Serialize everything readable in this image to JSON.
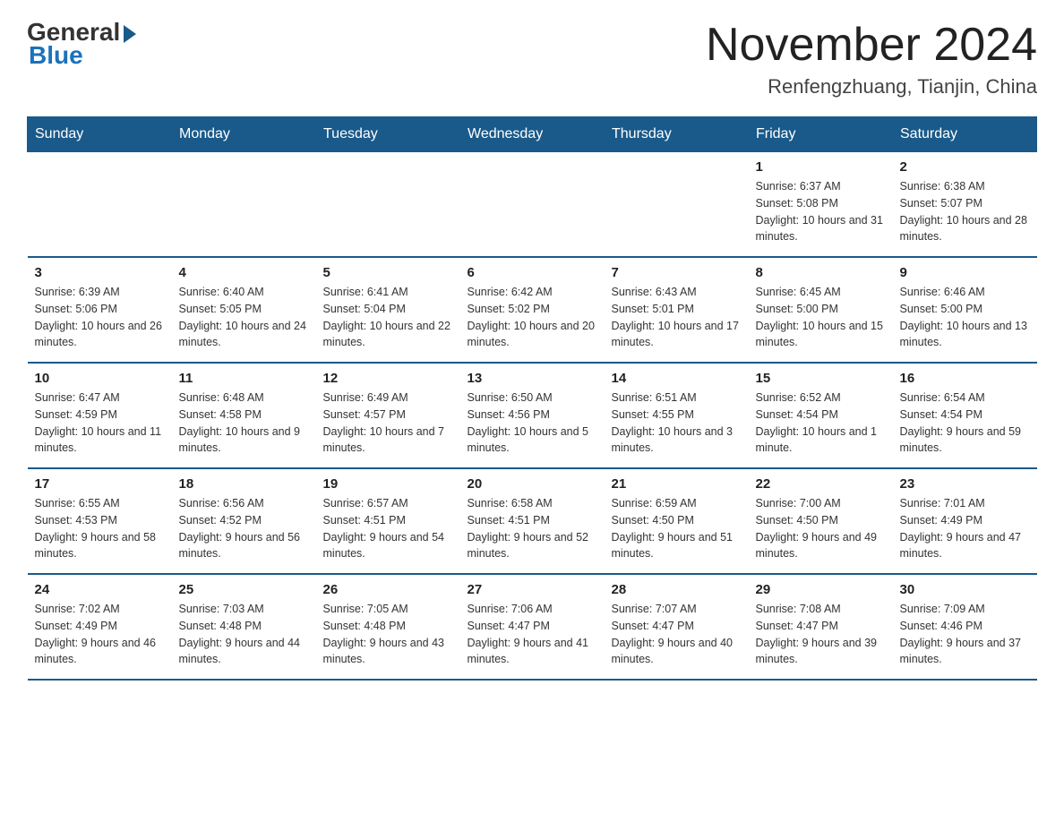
{
  "header": {
    "logo_general": "General",
    "logo_blue": "Blue",
    "month_title": "November 2024",
    "location": "Renfengzhuang, Tianjin, China"
  },
  "weekdays": [
    "Sunday",
    "Monday",
    "Tuesday",
    "Wednesday",
    "Thursday",
    "Friday",
    "Saturday"
  ],
  "rows": [
    [
      {
        "day": "",
        "info": ""
      },
      {
        "day": "",
        "info": ""
      },
      {
        "day": "",
        "info": ""
      },
      {
        "day": "",
        "info": ""
      },
      {
        "day": "",
        "info": ""
      },
      {
        "day": "1",
        "info": "Sunrise: 6:37 AM\nSunset: 5:08 PM\nDaylight: 10 hours and 31 minutes."
      },
      {
        "day": "2",
        "info": "Sunrise: 6:38 AM\nSunset: 5:07 PM\nDaylight: 10 hours and 28 minutes."
      }
    ],
    [
      {
        "day": "3",
        "info": "Sunrise: 6:39 AM\nSunset: 5:06 PM\nDaylight: 10 hours and 26 minutes."
      },
      {
        "day": "4",
        "info": "Sunrise: 6:40 AM\nSunset: 5:05 PM\nDaylight: 10 hours and 24 minutes."
      },
      {
        "day": "5",
        "info": "Sunrise: 6:41 AM\nSunset: 5:04 PM\nDaylight: 10 hours and 22 minutes."
      },
      {
        "day": "6",
        "info": "Sunrise: 6:42 AM\nSunset: 5:02 PM\nDaylight: 10 hours and 20 minutes."
      },
      {
        "day": "7",
        "info": "Sunrise: 6:43 AM\nSunset: 5:01 PM\nDaylight: 10 hours and 17 minutes."
      },
      {
        "day": "8",
        "info": "Sunrise: 6:45 AM\nSunset: 5:00 PM\nDaylight: 10 hours and 15 minutes."
      },
      {
        "day": "9",
        "info": "Sunrise: 6:46 AM\nSunset: 5:00 PM\nDaylight: 10 hours and 13 minutes."
      }
    ],
    [
      {
        "day": "10",
        "info": "Sunrise: 6:47 AM\nSunset: 4:59 PM\nDaylight: 10 hours and 11 minutes."
      },
      {
        "day": "11",
        "info": "Sunrise: 6:48 AM\nSunset: 4:58 PM\nDaylight: 10 hours and 9 minutes."
      },
      {
        "day": "12",
        "info": "Sunrise: 6:49 AM\nSunset: 4:57 PM\nDaylight: 10 hours and 7 minutes."
      },
      {
        "day": "13",
        "info": "Sunrise: 6:50 AM\nSunset: 4:56 PM\nDaylight: 10 hours and 5 minutes."
      },
      {
        "day": "14",
        "info": "Sunrise: 6:51 AM\nSunset: 4:55 PM\nDaylight: 10 hours and 3 minutes."
      },
      {
        "day": "15",
        "info": "Sunrise: 6:52 AM\nSunset: 4:54 PM\nDaylight: 10 hours and 1 minute."
      },
      {
        "day": "16",
        "info": "Sunrise: 6:54 AM\nSunset: 4:54 PM\nDaylight: 9 hours and 59 minutes."
      }
    ],
    [
      {
        "day": "17",
        "info": "Sunrise: 6:55 AM\nSunset: 4:53 PM\nDaylight: 9 hours and 58 minutes."
      },
      {
        "day": "18",
        "info": "Sunrise: 6:56 AM\nSunset: 4:52 PM\nDaylight: 9 hours and 56 minutes."
      },
      {
        "day": "19",
        "info": "Sunrise: 6:57 AM\nSunset: 4:51 PM\nDaylight: 9 hours and 54 minutes."
      },
      {
        "day": "20",
        "info": "Sunrise: 6:58 AM\nSunset: 4:51 PM\nDaylight: 9 hours and 52 minutes."
      },
      {
        "day": "21",
        "info": "Sunrise: 6:59 AM\nSunset: 4:50 PM\nDaylight: 9 hours and 51 minutes."
      },
      {
        "day": "22",
        "info": "Sunrise: 7:00 AM\nSunset: 4:50 PM\nDaylight: 9 hours and 49 minutes."
      },
      {
        "day": "23",
        "info": "Sunrise: 7:01 AM\nSunset: 4:49 PM\nDaylight: 9 hours and 47 minutes."
      }
    ],
    [
      {
        "day": "24",
        "info": "Sunrise: 7:02 AM\nSunset: 4:49 PM\nDaylight: 9 hours and 46 minutes."
      },
      {
        "day": "25",
        "info": "Sunrise: 7:03 AM\nSunset: 4:48 PM\nDaylight: 9 hours and 44 minutes."
      },
      {
        "day": "26",
        "info": "Sunrise: 7:05 AM\nSunset: 4:48 PM\nDaylight: 9 hours and 43 minutes."
      },
      {
        "day": "27",
        "info": "Sunrise: 7:06 AM\nSunset: 4:47 PM\nDaylight: 9 hours and 41 minutes."
      },
      {
        "day": "28",
        "info": "Sunrise: 7:07 AM\nSunset: 4:47 PM\nDaylight: 9 hours and 40 minutes."
      },
      {
        "day": "29",
        "info": "Sunrise: 7:08 AM\nSunset: 4:47 PM\nDaylight: 9 hours and 39 minutes."
      },
      {
        "day": "30",
        "info": "Sunrise: 7:09 AM\nSunset: 4:46 PM\nDaylight: 9 hours and 37 minutes."
      }
    ]
  ]
}
